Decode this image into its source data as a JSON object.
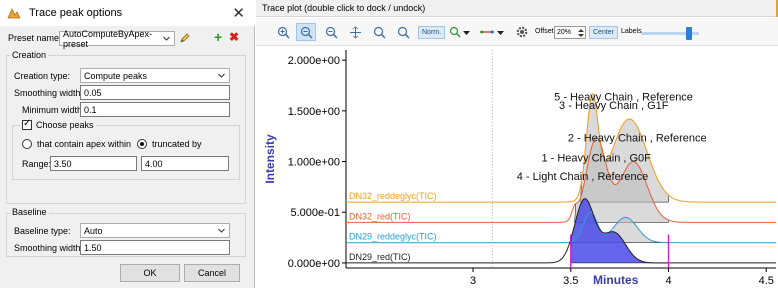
{
  "dialog": {
    "title": "Trace peak options",
    "preset_label": "Preset name:",
    "preset_value": "AutoComputeByApex-preset",
    "creation": {
      "title": "Creation",
      "type_label": "Creation type:",
      "type_value": "Compute peaks",
      "smoothing_label": "Smoothing width:",
      "smoothing_value": "0.05",
      "min_width_label": "Minimum width:",
      "min_width_value": "0.1",
      "choose_peaks_label": "Choose peaks",
      "radio_apex_label": "that contain apex within",
      "radio_truncated_label": "truncated by",
      "range_label": "Range:",
      "range_from": "3.50",
      "range_to": "4.00"
    },
    "baseline": {
      "title": "Baseline",
      "type_label": "Baseline type:",
      "type_value": "Auto",
      "smoothing_label": "Smoothing width:",
      "smoothing_value": "1.50"
    },
    "ok_label": "OK",
    "cancel_label": "Cancel"
  },
  "trace_plot": {
    "header": "Trace plot (double click to dock / undock)",
    "toolbar": {
      "norm_label": "Norm.",
      "offset_label": "Offset:",
      "offset_value": "20%",
      "center_label": "Center",
      "labels_label": "Labels"
    }
  },
  "chart_data": {
    "type": "line",
    "xlabel": "Minutes",
    "ylabel": "Intensity",
    "xlim": [
      2.35,
      4.55
    ],
    "ylim": [
      -0.05,
      2.1
    ],
    "x_ticks": [
      3,
      3.5,
      4,
      4.5
    ],
    "x_tick_labels": [
      "3",
      "3.5",
      "4",
      "4.5"
    ],
    "y_ticks": [
      0,
      0.5,
      1.0,
      1.5,
      2.0
    ],
    "y_tick_labels": [
      "0.000e+00",
      "5.000e-01",
      "1.000e+00",
      "1.500e+00",
      "2.000e+00"
    ],
    "series": [
      {
        "name": "DN32_reddeglyc(TIC)",
        "color": "#f0a020",
        "offset": 0.6,
        "peaks": [
          {
            "center": 3.61,
            "height": 0.98,
            "width": 0.03
          },
          {
            "center": 3.8,
            "height": 0.82,
            "width": 0.09
          }
        ],
        "fill_range": [
          3.55,
          4.0
        ]
      },
      {
        "name": "DN32_red(TIC)",
        "color": "#e8603c",
        "offset": 0.4,
        "peaks": [
          {
            "center": 3.52,
            "height": 0.1,
            "width": 0.015
          },
          {
            "center": 3.63,
            "height": 0.82,
            "width": 0.05
          },
          {
            "center": 3.82,
            "height": 0.6,
            "width": 0.07
          }
        ],
        "fill_range": [
          3.52,
          4.0
        ]
      },
      {
        "name": "DN29_reddeglyc(TIC)",
        "color": "#2a9fd6",
        "offset": 0.2,
        "peaks": [
          {
            "center": 3.6,
            "height": 0.3,
            "width": 0.035
          },
          {
            "center": 3.78,
            "height": 0.25,
            "width": 0.06
          }
        ],
        "fill_range": [
          3.5,
          4.0
        ]
      },
      {
        "name": "DN29_red(TIC)",
        "color": "#222222",
        "offset": 0.0,
        "peaks": [
          {
            "center": 3.57,
            "height": 0.62,
            "width": 0.05
          },
          {
            "center": 3.72,
            "height": 0.3,
            "width": 0.06
          }
        ],
        "fill_range": [
          3.5,
          4.0
        ]
      }
    ],
    "annotations": [
      {
        "text": "5 - Heavy Chain , Reference",
        "x": 3.77,
        "y": 1.6
      },
      {
        "text": "3 - Heavy Chain , G1F",
        "x": 3.72,
        "y": 1.52
      },
      {
        "text": "2 - Heavy Chain , Reference",
        "x": 3.84,
        "y": 1.2
      },
      {
        "text": "1 - Heavy Chain , G0F",
        "x": 3.63,
        "y": 1.0
      },
      {
        "text": "4 - Light Chain , Reference",
        "x": 3.56,
        "y": 0.82
      }
    ],
    "range_markers": [
      3.5,
      4.0
    ],
    "grid": false
  }
}
